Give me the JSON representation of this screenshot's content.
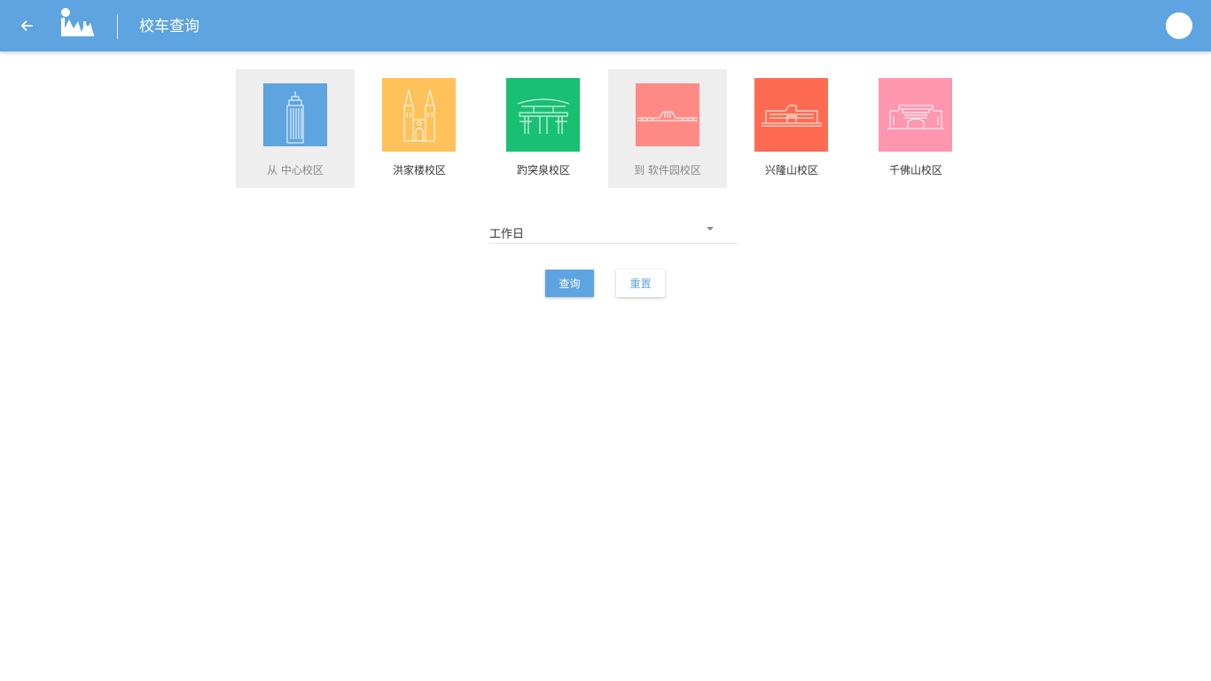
{
  "header": {
    "title": "校车查询",
    "back_icon": "arrow-left-icon",
    "logo_icon": "university-logo-icon",
    "avatar_icon": "user-avatar-icon",
    "bar_color": "#5da4e0"
  },
  "campuses": [
    {
      "prefix": "从",
      "name": "中心校区",
      "color": "#5da4e0",
      "icon": "tower-building-icon",
      "selected": true
    },
    {
      "prefix": "",
      "name": "洪家楼校区",
      "color": "#ffc15a",
      "icon": "cathedral-icon",
      "selected": false
    },
    {
      "prefix": "",
      "name": "趵突泉校区",
      "color": "#19bf72",
      "icon": "archway-gate-icon",
      "selected": false
    },
    {
      "prefix": "到",
      "name": "软件园校区",
      "color": "#ff8a85",
      "icon": "low-building-icon",
      "selected": true
    },
    {
      "prefix": "",
      "name": "兴隆山校区",
      "color": "#ff6b52",
      "icon": "wide-hall-icon",
      "selected": false
    },
    {
      "prefix": "",
      "name": "千佛山校区",
      "color": "#ff96b0",
      "icon": "modern-building-icon",
      "selected": false
    }
  ],
  "day_select": {
    "value": "工作日",
    "icon": "caret-down-icon"
  },
  "actions": {
    "query_label": "查询",
    "reset_label": "重置"
  }
}
